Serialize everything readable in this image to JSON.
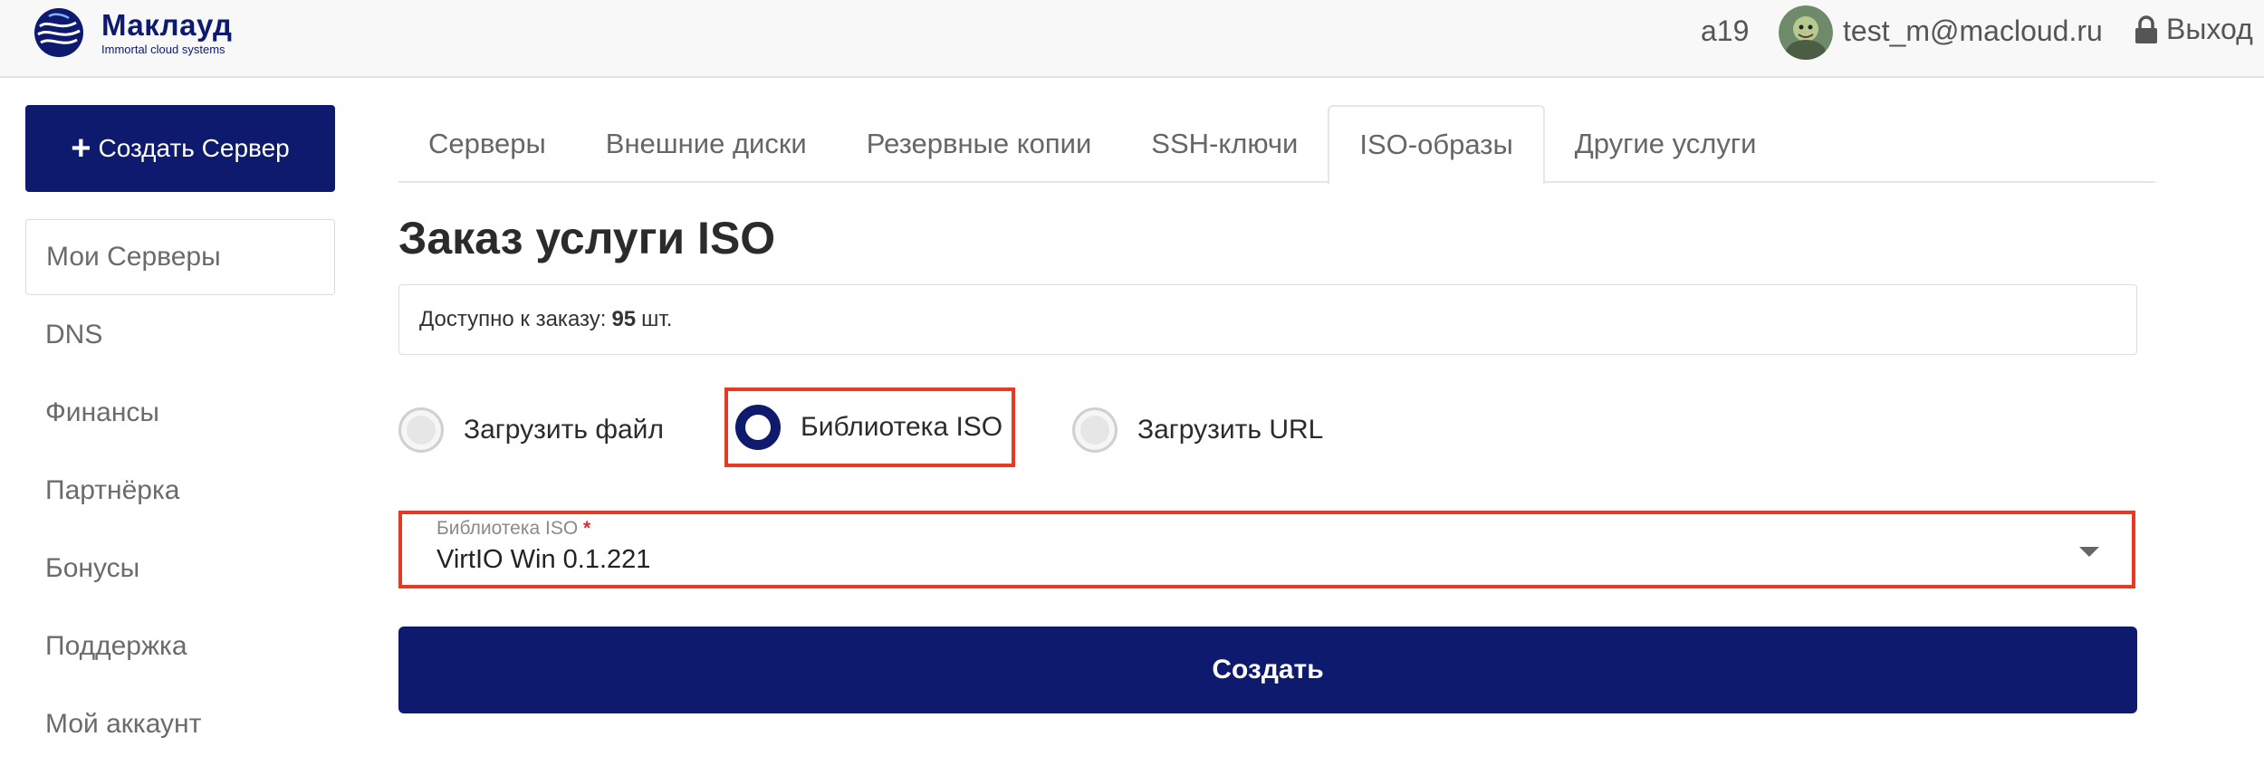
{
  "header": {
    "logo_name": "Маклауд",
    "logo_tagline": "Immortal cloud systems",
    "account_id": "a19",
    "email": "test_m@macloud.ru",
    "logout_label": "Выход"
  },
  "sidebar": {
    "create_button": "Создать Сервер",
    "items": [
      {
        "label": "Мои Серверы",
        "active": true
      },
      {
        "label": "DNS"
      },
      {
        "label": "Финансы"
      },
      {
        "label": "Партнёрка"
      },
      {
        "label": "Бонусы"
      },
      {
        "label": "Поддержка"
      },
      {
        "label": "Мой аккаунт"
      }
    ]
  },
  "tabs": [
    {
      "label": "Серверы"
    },
    {
      "label": "Внешние диски"
    },
    {
      "label": "Резервные копии"
    },
    {
      "label": "SSH-ключи"
    },
    {
      "label": "ISO-образы",
      "active": true
    },
    {
      "label": "Другие услуги"
    }
  ],
  "main": {
    "title": "Заказ услуги ISO",
    "availability": {
      "prefix": "Доступно к заказу:",
      "count": "95",
      "unit": "шт."
    },
    "radio_options": [
      {
        "label": "Загрузить файл",
        "checked": false
      },
      {
        "label": "Библиотека ISO",
        "checked": true
      },
      {
        "label": "Загрузить URL",
        "checked": false
      }
    ],
    "iso_select": {
      "label": "Библиотека ISO",
      "required_mark": "*",
      "value": "VirtIO Win 0.1.221"
    },
    "submit_label": "Создать"
  },
  "colors": {
    "primary": "#0d1a6e",
    "highlight": "#e53b24"
  },
  "icons": {
    "logo": "maklaud-logo-icon",
    "logout": "lock-icon",
    "create": "plus-icon",
    "dropdown": "caret-down-icon"
  }
}
